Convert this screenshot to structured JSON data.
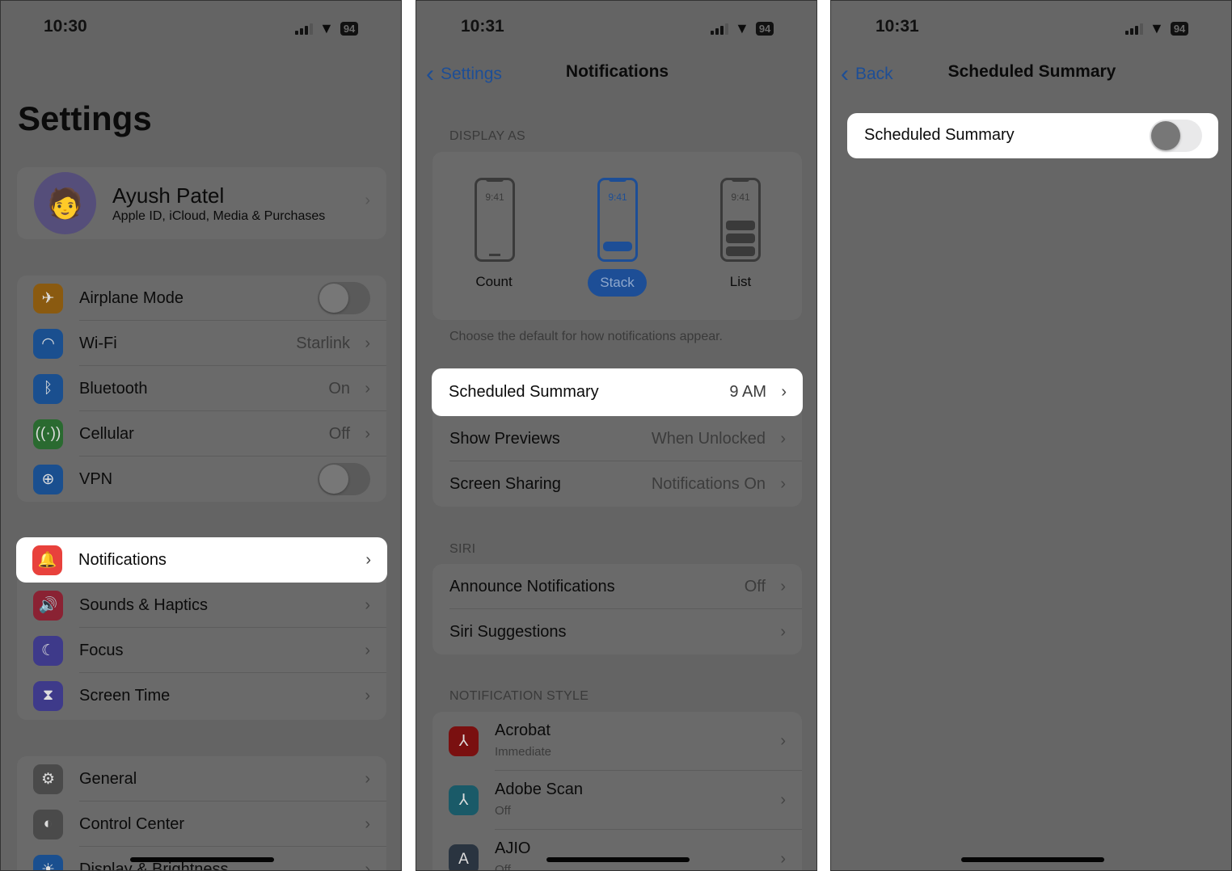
{
  "colors": {
    "accent": "#1d4e96",
    "highlight": "#ffffff",
    "dim_bg": "#646464"
  },
  "panel1": {
    "status": {
      "time": "10:30",
      "battery": "94"
    },
    "title": "Settings",
    "profile": {
      "name": "Ayush Patel",
      "subtitle": "Apple ID, iCloud, Media & Purchases"
    },
    "group1": [
      {
        "label": "Airplane Mode",
        "icon": "airplane-icon",
        "color": "#8a5a10",
        "toggle": false
      },
      {
        "label": "Wi-Fi",
        "value": "Starlink",
        "icon": "wifi-icon",
        "color": "#1a4f8f"
      },
      {
        "label": "Bluetooth",
        "value": "On",
        "icon": "bluetooth-icon",
        "color": "#1a4f8f"
      },
      {
        "label": "Cellular",
        "value": "Off",
        "icon": "cellular-icon",
        "color": "#2a6a30"
      },
      {
        "label": "VPN",
        "icon": "globe-icon",
        "color": "#1a4f8f",
        "toggle": false
      }
    ],
    "group2": [
      {
        "label": "Notifications",
        "icon": "bell-icon",
        "color": "#e8413c",
        "highlighted": true
      },
      {
        "label": "Sounds & Haptics",
        "icon": "speaker-icon",
        "color": "#8a2233"
      },
      {
        "label": "Focus",
        "icon": "moon-icon",
        "color": "#3e3a8a"
      },
      {
        "label": "Screen Time",
        "icon": "hourglass-icon",
        "color": "#3e3a8a"
      }
    ],
    "group3": [
      {
        "label": "General",
        "icon": "gear-icon",
        "color": "#4a4a4a"
      },
      {
        "label": "Control Center",
        "icon": "switches-icon",
        "color": "#4a4a4a"
      },
      {
        "label": "Display & Brightness",
        "icon": "sun-icon",
        "color": "#1a4f8f"
      }
    ]
  },
  "panel2": {
    "status": {
      "time": "10:31",
      "battery": "94"
    },
    "back": "Settings",
    "title": "Notifications",
    "display_as": {
      "header": "DISPLAY AS",
      "options": [
        {
          "label": "Count",
          "clock": "9:41"
        },
        {
          "label": "Stack",
          "clock": "9:41",
          "selected": true
        },
        {
          "label": "List",
          "clock": "9:41"
        }
      ],
      "footer": "Choose the default for how notifications appear."
    },
    "group1": [
      {
        "label": "Scheduled Summary",
        "value": "9 AM",
        "highlighted": true
      },
      {
        "label": "Show Previews",
        "value": "When Unlocked"
      },
      {
        "label": "Screen Sharing",
        "value": "Notifications On"
      }
    ],
    "siri": {
      "header": "SIRI",
      "rows": [
        {
          "label": "Announce Notifications",
          "value": "Off"
        },
        {
          "label": "Siri Suggestions"
        }
      ]
    },
    "style": {
      "header": "NOTIFICATION STYLE",
      "apps": [
        {
          "name": "Acrobat",
          "sub": "Immediate",
          "color": "#7a1010"
        },
        {
          "name": "Adobe Scan",
          "sub": "Off",
          "color": "#1a5a68"
        },
        {
          "name": "AJIO",
          "sub": "Off",
          "color": "#2a3440"
        }
      ]
    }
  },
  "panel3": {
    "status": {
      "time": "10:31",
      "battery": "94"
    },
    "back": "Back",
    "title": "Scheduled Summary",
    "row": {
      "label": "Scheduled Summary",
      "toggle": false
    }
  }
}
